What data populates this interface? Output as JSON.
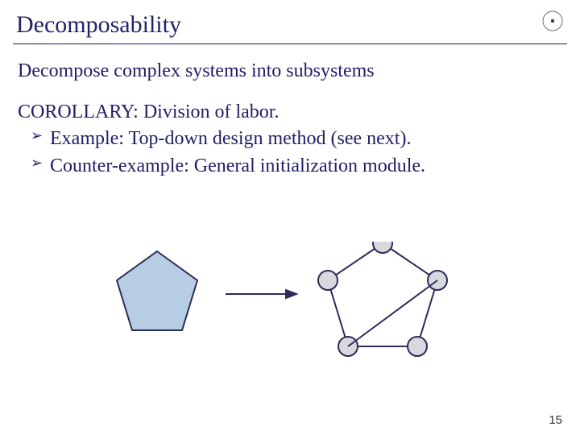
{
  "slide": {
    "title": "Decomposability",
    "lead": "Decompose complex systems into subsystems",
    "corollary": "COROLLARY: Division of labor.",
    "bullets": {
      "b1": "Example: Top-down design method (see next).",
      "b2": "Counter-example: General initialization module."
    },
    "page_number": "15"
  }
}
